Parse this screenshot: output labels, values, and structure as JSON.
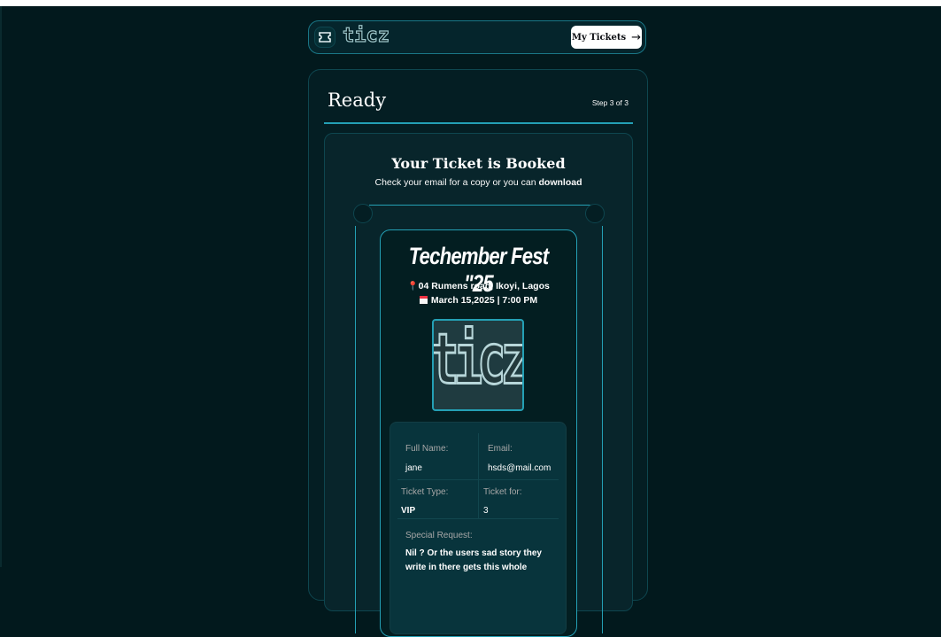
{
  "header": {
    "logo_text": "ticz",
    "my_tickets_label": "My Tickets",
    "arrow_icon": "→"
  },
  "step": {
    "title": "Ready",
    "count": "Step 3 of 3",
    "progress": 1.0
  },
  "booked": {
    "title": "Your Ticket is Booked",
    "subtitle_prefix": "Check your email for a copy or you can ",
    "subtitle_link": "download"
  },
  "ticket": {
    "event_name": "Techember Fest \"25",
    "location_icon": "📍",
    "location": "04 Rumens road, Ikoyi, Lagos",
    "date": "March 15,2025 | 7:00 PM",
    "image_text": "ticz",
    "details": {
      "full_name_label": "Full Name:",
      "full_name": "jane",
      "email_label": "Email:",
      "email": "hsds@mail.com",
      "ticket_type_label": "Ticket Type:",
      "ticket_type": "VIP",
      "ticket_for_label": "Ticket for:",
      "ticket_for": "3",
      "special_request_label": "Special Request:",
      "special_request": "Nil ? Or the users sad story they write in there gets this whole"
    }
  },
  "colors": {
    "background": "#02191d",
    "accent": "#24a0b5",
    "border": "#0e464f"
  }
}
